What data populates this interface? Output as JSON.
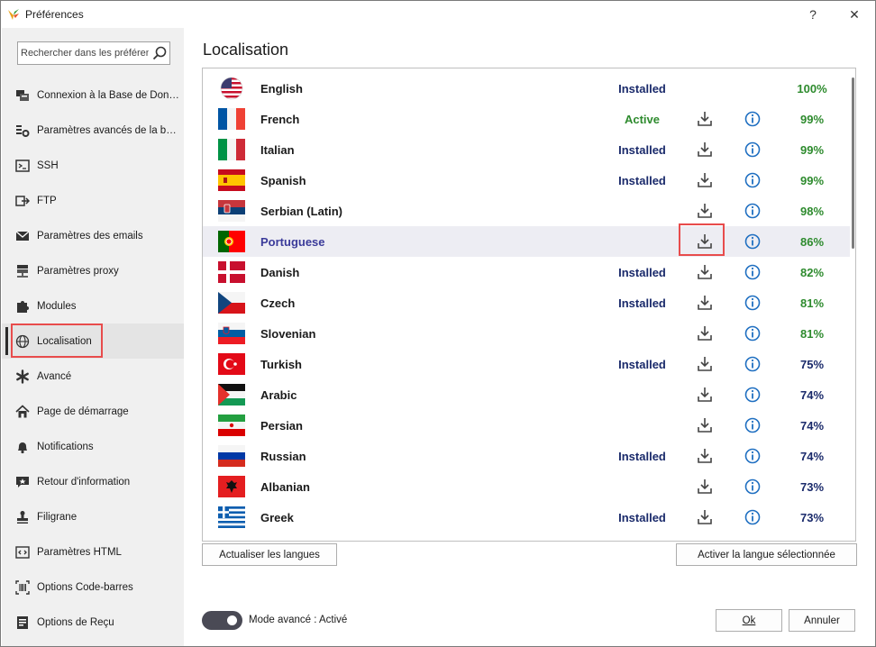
{
  "window": {
    "title": "Préférences",
    "help_glyph": "?",
    "close_glyph": "✕"
  },
  "sidebar": {
    "search_placeholder": "Rechercher dans les préférences",
    "items": [
      {
        "label": "Connexion à la Base de Données",
        "icon": "database-icon"
      },
      {
        "label": "Paramètres avancés de la base de données",
        "icon": "database-settings-icon"
      },
      {
        "label": "SSH",
        "icon": "terminal-icon"
      },
      {
        "label": "FTP",
        "icon": "ftp-icon"
      },
      {
        "label": "Paramètres des emails",
        "icon": "email-icon"
      },
      {
        "label": "Paramètres proxy",
        "icon": "proxy-icon"
      },
      {
        "label": "Modules",
        "icon": "puzzle-icon"
      },
      {
        "label": "Localisation",
        "icon": "globe-icon",
        "selected": true
      },
      {
        "label": "Avancé",
        "icon": "asterisk-icon"
      },
      {
        "label": "Page de démarrage",
        "icon": "home-icon"
      },
      {
        "label": "Notifications",
        "icon": "bell-icon"
      },
      {
        "label": "Retour d'information",
        "icon": "feedback-icon"
      },
      {
        "label": "Filigrane",
        "icon": "stamp-icon"
      },
      {
        "label": "Paramètres HTML",
        "icon": "html-icon"
      },
      {
        "label": "Options Code-barres",
        "icon": "barcode-icon"
      },
      {
        "label": "Options de Reçu",
        "icon": "receipt-icon"
      }
    ]
  },
  "main": {
    "title": "Localisation",
    "languages": [
      {
        "name": "English",
        "status": "Installed",
        "download": false,
        "info": false,
        "percent": "100%",
        "flag": "us"
      },
      {
        "name": "French",
        "status": "Active",
        "download": true,
        "info": true,
        "percent": "99%",
        "flag": "fr"
      },
      {
        "name": "Italian",
        "status": "Installed",
        "download": true,
        "info": true,
        "percent": "99%",
        "flag": "it"
      },
      {
        "name": "Spanish",
        "status": "Installed",
        "download": true,
        "info": true,
        "percent": "99%",
        "flag": "es"
      },
      {
        "name": "Serbian (Latin)",
        "status": "",
        "download": true,
        "info": true,
        "percent": "98%",
        "flag": "rs"
      },
      {
        "name": "Portuguese",
        "status": "",
        "download": true,
        "info": true,
        "percent": "86%",
        "flag": "pt",
        "selected": true
      },
      {
        "name": "Danish",
        "status": "Installed",
        "download": true,
        "info": true,
        "percent": "82%",
        "flag": "dk"
      },
      {
        "name": "Czech",
        "status": "Installed",
        "download": true,
        "info": true,
        "percent": "81%",
        "flag": "cz"
      },
      {
        "name": "Slovenian",
        "status": "",
        "download": true,
        "info": true,
        "percent": "81%",
        "flag": "si"
      },
      {
        "name": "Turkish",
        "status": "Installed",
        "download": true,
        "info": true,
        "percent": "75%",
        "flag": "tr"
      },
      {
        "name": "Arabic",
        "status": "",
        "download": true,
        "info": true,
        "percent": "74%",
        "flag": "ps"
      },
      {
        "name": "Persian",
        "status": "",
        "download": true,
        "info": true,
        "percent": "74%",
        "flag": "ir"
      },
      {
        "name": "Russian",
        "status": "Installed",
        "download": true,
        "info": true,
        "percent": "74%",
        "flag": "ru"
      },
      {
        "name": "Albanian",
        "status": "",
        "download": true,
        "info": true,
        "percent": "73%",
        "flag": "al"
      },
      {
        "name": "Greek",
        "status": "Installed",
        "download": true,
        "info": true,
        "percent": "73%",
        "flag": "gr"
      }
    ],
    "update_button": "Actualiser les langues",
    "activate_button": "Activer la langue sélectionnée"
  },
  "footer": {
    "toggle_label": "Mode avancé : Activé",
    "toggle_on": true,
    "ok_button": "Ok",
    "cancel_button": "Annuler"
  },
  "colors": {
    "installed": "#1a2a6b",
    "active": "#2e8b2e",
    "highlight": "#e84c4c",
    "icon_blue": "#1f6fc1"
  }
}
